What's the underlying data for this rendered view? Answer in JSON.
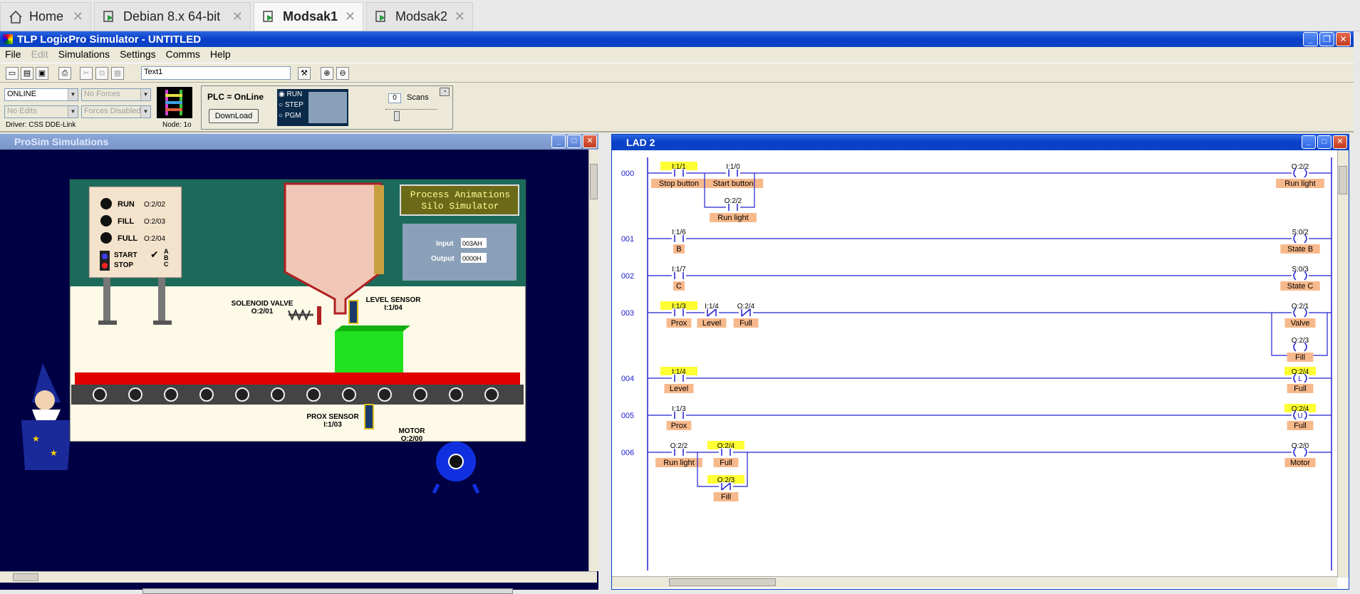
{
  "vm_tabs": [
    {
      "label": "Home",
      "icon": "home-icon",
      "active": false
    },
    {
      "label": "Debian 8.x 64-bit",
      "icon": "vm-icon",
      "active": false
    },
    {
      "label": "Modsak1",
      "icon": "vm-icon",
      "active": true
    },
    {
      "label": "Modsak2",
      "icon": "vm-icon",
      "active": false
    }
  ],
  "app": {
    "title": "TLP LogixPro Simulator  -  UNTITLED",
    "menu": [
      "File",
      "Edit",
      "Simulations",
      "Settings",
      "Comms",
      "Help"
    ],
    "toolbar_text": "Text1"
  },
  "status": {
    "mode": "ONLINE",
    "forces": "No Forces",
    "edits": "No Edits",
    "forces_disabled": "Forces Disabled",
    "driver": "Driver: CSS DDE-Link",
    "node": "Node: 1o",
    "plc_state": "PLC = OnLine",
    "download": "DownLoad",
    "run": "RUN",
    "step": "STEP",
    "pgm": "PGM",
    "scans_value": "0",
    "scans_label": "Scans"
  },
  "sim_window": {
    "title": "ProSim Simulations",
    "lights": [
      {
        "name": "RUN",
        "addr": "O:2/02"
      },
      {
        "name": "FILL",
        "addr": "O:2/03"
      },
      {
        "name": "FULL",
        "addr": "O:2/04"
      }
    ],
    "start": "START",
    "stop": "STOP",
    "abc": [
      "A",
      "B",
      "C"
    ],
    "banner_line1": "Process Animations",
    "banner_line2": "Silo Simulator",
    "input_label": "Input",
    "input_value": "003AH",
    "output_label": "Output",
    "output_value": "0000H",
    "solenoid_label": "SOLENOID VALVE",
    "solenoid_addr": "O:2/01",
    "level_label": "LEVEL SENSOR",
    "level_addr": "I:1/04",
    "prox_label": "PROX SENSOR",
    "prox_addr": "I:1/03",
    "motor_label": "MOTOR",
    "motor_addr": "O:2/00"
  },
  "lad_window": {
    "title": "LAD 2",
    "rungs": [
      {
        "num": "000",
        "contacts": [
          {
            "addr": "I:1/1",
            "label": "Stop button",
            "type": "XIC",
            "hl": true
          },
          {
            "addr": "I:1/0",
            "label": "Start button",
            "type": "XIC",
            "hl": false
          }
        ],
        "branch": [
          {
            "addr": "O:2/2",
            "label": "Run light",
            "type": "XIC",
            "hl": false
          }
        ],
        "coils": [
          {
            "addr": "O:2/2",
            "label": "Run light",
            "sym": "",
            "hl": false
          }
        ]
      },
      {
        "num": "001",
        "contacts": [
          {
            "addr": "I:1/6",
            "label": "B",
            "type": "XIC",
            "hl": false
          }
        ],
        "coils": [
          {
            "addr": "S:0/2",
            "label": "State B",
            "sym": "",
            "hl": false
          }
        ]
      },
      {
        "num": "002",
        "contacts": [
          {
            "addr": "I:1/7",
            "label": "C",
            "type": "XIC",
            "hl": false
          }
        ],
        "coils": [
          {
            "addr": "S:0/3",
            "label": "State C",
            "sym": "",
            "hl": false
          }
        ]
      },
      {
        "num": "003",
        "contacts": [
          {
            "addr": "I:1/3",
            "label": "Prox",
            "type": "XIC",
            "hl": true
          },
          {
            "addr": "I:1/4",
            "label": "Level",
            "type": "XIO",
            "hl": false
          },
          {
            "addr": "O:2/4",
            "label": "Full",
            "type": "XIO",
            "hl": false
          }
        ],
        "coils": [
          {
            "addr": "O:2/1",
            "label": "Valve",
            "sym": "",
            "hl": false
          },
          {
            "addr": "O:2/3",
            "label": "Fill",
            "sym": "",
            "hl": false
          }
        ]
      },
      {
        "num": "004",
        "contacts": [
          {
            "addr": "I:1/4",
            "label": "Level",
            "type": "XIC",
            "hl": true
          }
        ],
        "coils": [
          {
            "addr": "O:2/4",
            "label": "Full",
            "sym": "L",
            "hl": true
          }
        ]
      },
      {
        "num": "005",
        "contacts": [
          {
            "addr": "I:1/3",
            "label": "Prox",
            "type": "XIC",
            "hl": false
          }
        ],
        "coils": [
          {
            "addr": "O:2/4",
            "label": "Full",
            "sym": "U",
            "hl": true
          }
        ]
      },
      {
        "num": "006",
        "contacts": [
          {
            "addr": "O:2/2",
            "label": "Run light",
            "type": "XIC",
            "hl": false
          },
          {
            "addr": "O:2/4",
            "label": "Full",
            "type": "XIC",
            "hl": true
          }
        ],
        "branch": [
          {
            "addr": "O:2/3",
            "label": "Fill",
            "type": "XIO",
            "hl": true
          }
        ],
        "coils": [
          {
            "addr": "O:2/0",
            "label": "Motor",
            "sym": "",
            "hl": false
          }
        ]
      }
    ]
  },
  "colors": {
    "label_bg": "#f7b98b",
    "addr_hl": "#ffff33",
    "rung": "#2020d0",
    "title_active": "#0a3fc8"
  }
}
